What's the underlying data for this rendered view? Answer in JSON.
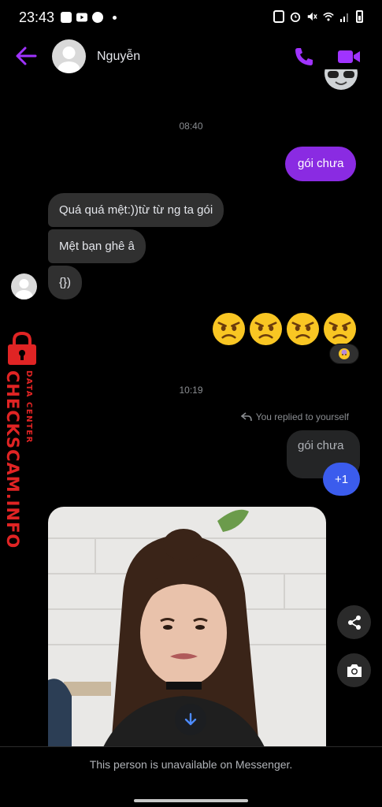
{
  "status_bar": {
    "time": "23:43",
    "left_icons": [
      "gallery-icon",
      "youtube-icon",
      "messenger-icon"
    ],
    "right_icons": [
      "recycle-icon",
      "alarm-icon",
      "mute-icon",
      "wifi-icon",
      "signal-icon",
      "battery-icon"
    ]
  },
  "header": {
    "contact_name": "Nguyễn",
    "accent_color": "#a033ff"
  },
  "messages": {
    "time_1": "08:40",
    "outgoing_1": "gói chưa",
    "incoming_1": "Quá quá mệt:))từ từ ng ta gói",
    "incoming_2": "Mệt bạn ghê â",
    "incoming_3": "{})",
    "emoji_count": 4,
    "time_2": "10:19",
    "reply_note": "You replied to yourself",
    "reply_quote": "gói chưa",
    "reply_text": "+1"
  },
  "footer": {
    "unavailable_text": "This person is unavailable on Messenger."
  },
  "watermark": {
    "brand": "CHECKSCAM.INFO",
    "tagline": "DATA CENTER"
  },
  "colors": {
    "outgoing_bubble": "#8a2be2",
    "incoming_bubble": "#303030",
    "plus_bubble": "#3b5ced",
    "watermark_red": "#e02424"
  }
}
